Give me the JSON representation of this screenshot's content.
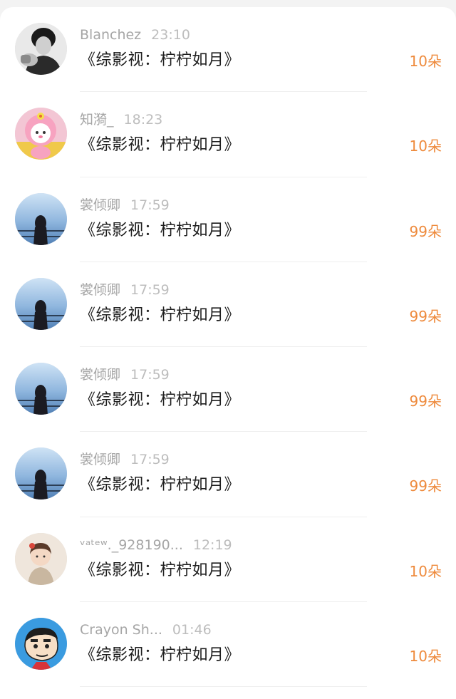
{
  "messages": [
    {
      "name": "Blanchez",
      "time": "23:10",
      "text": "《综影视：柠柠如月》",
      "gift": "10朵",
      "avatar": "bw-portrait"
    },
    {
      "name": "知漪_",
      "time": "18:23",
      "text": "《综影视：柠柠如月》",
      "gift": "10朵",
      "avatar": "pink-sheep"
    },
    {
      "name": "裳倾卿",
      "time": "17:59",
      "text": "《综影视：柠柠如月》",
      "gift": "99朵",
      "avatar": "sea-girl"
    },
    {
      "name": "裳倾卿",
      "time": "17:59",
      "text": "《综影视：柠柠如月》",
      "gift": "99朵",
      "avatar": "sea-girl"
    },
    {
      "name": "裳倾卿",
      "time": "17:59",
      "text": "《综影视：柠柠如月》",
      "gift": "99朵",
      "avatar": "sea-girl"
    },
    {
      "name": "裳倾卿",
      "time": "17:59",
      "text": "《综影视：柠柠如月》",
      "gift": "99朵",
      "avatar": "sea-girl"
    },
    {
      "name": "ᵛᵃᵗᵉʷ._928190...",
      "time": "12:19",
      "text": "《综影视：柠柠如月》",
      "gift": "10朵",
      "avatar": "baby"
    },
    {
      "name": "Crayon Sh...",
      "time": "01:46",
      "text": "《综影视：柠柠如月》",
      "gift": "10朵",
      "avatar": "cartoon-boy"
    }
  ],
  "colors": {
    "gift": "#ee8a3c",
    "name": "#a6a6a6",
    "time": "#bdbdbd",
    "text": "#1e1e1e"
  }
}
